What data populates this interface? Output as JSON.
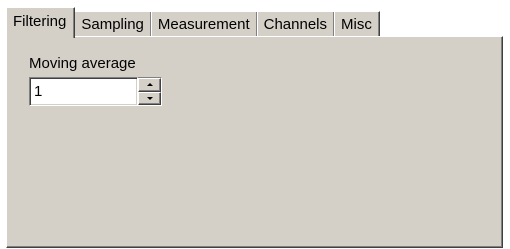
{
  "tabs": [
    {
      "label": "Filtering",
      "active": true
    },
    {
      "label": "Sampling",
      "active": false
    },
    {
      "label": "Measurement",
      "active": false
    },
    {
      "label": "Channels",
      "active": false
    },
    {
      "label": "Misc",
      "active": false
    }
  ],
  "filtering": {
    "moving_average_label": "Moving average",
    "moving_average_value": "1"
  },
  "colors": {
    "face": "#d4d0c8",
    "highlight": "#ffffff",
    "shadow": "#808080",
    "dark_shadow": "#404040"
  },
  "icons": {
    "spin_up": "arrow-up-icon",
    "spin_down": "arrow-down-icon"
  }
}
